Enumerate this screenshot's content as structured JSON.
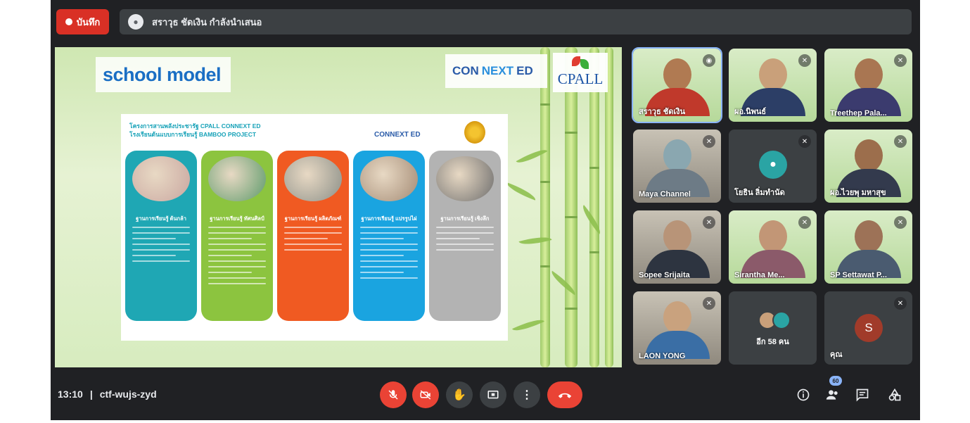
{
  "top_bar": {
    "record_label": "บันทึก",
    "presenter_text": "สราวุธ ชัดเงิน กำลังนำเสนอ"
  },
  "slide": {
    "title": "school model",
    "logo_connext_prefix": "CON",
    "logo_connext_next": "NEXT",
    "logo_connext_suffix": "ED",
    "logo_cpall": "CPALL",
    "panel_heading_line1": "โครงการสานพลังประชารัฐ CPALL CONNEXT ED",
    "panel_heading_line2": "โรงเรียนต้นแบบการเรียนรู้ BAMBOO PROJECT",
    "panel_logo": "CONNEXT ED",
    "pillars": [
      {
        "title": "ฐานการเรียนรู้ ต้นกล้า",
        "color": "#1fa7b4",
        "photo": "#c9a6a0",
        "lines": 7
      },
      {
        "title": "ฐานการเรียนรู้ ทัศนศิลป์",
        "color": "#8cc43f",
        "photo": "#5c9a6a",
        "lines": 11
      },
      {
        "title": "ฐานการเรียนรู้ ผลิตภัณฑ์",
        "color": "#f05a22",
        "photo": "#8b8f88",
        "lines": 5
      },
      {
        "title": "ฐานการเรียนรู้ แปรรูปไผ่",
        "color": "#1aa4e0",
        "photo": "#a38a74",
        "lines": 10
      },
      {
        "title": "ฐานการเรียนรู้ เชิงลึก",
        "color": "#b3b3b3",
        "photo": "#6d6d6d",
        "lines": 5
      }
    ]
  },
  "participants": [
    {
      "name": "สราวุธ ชัดเงิน",
      "style": "green",
      "skin": "#b07a52",
      "shirt": "#c0392b",
      "speaking": true
    },
    {
      "name": "ผอ.นิพนธ์",
      "style": "green",
      "skin": "#c9a07a",
      "shirt": "#2c3e66"
    },
    {
      "name": "Treethep Pala...",
      "style": "green",
      "skin": "#a97652",
      "shirt": "#3b3b6e"
    },
    {
      "name": "Maya Channel",
      "style": "room",
      "skin": "#8aa7b0",
      "shirt": "#6d7b86"
    },
    {
      "name": "โยธิน ลิ่มทำนัด",
      "style": "avatar"
    },
    {
      "name": "ผอ.ไวยพุ มหาสุข",
      "style": "green",
      "skin": "#9c6e4c",
      "shirt": "#333a4d"
    },
    {
      "name": "Sopee Srijaita",
      "style": "room",
      "skin": "#b89478",
      "shirt": "#2d3440"
    },
    {
      "name": "Sirantha Me...",
      "style": "green",
      "skin": "#c29676",
      "shirt": "#8b5a6a"
    },
    {
      "name": "SP Settawat P...",
      "style": "green",
      "skin": "#9d7257",
      "shirt": "#4a5b70"
    },
    {
      "name": "LAON YONG",
      "style": "room",
      "skin": "#c9a27e",
      "shirt": "#3a6ea5"
    },
    {
      "name": "อีก 58 คน",
      "style": "others"
    },
    {
      "name": "คุณ",
      "style": "self",
      "initial": "S"
    }
  ],
  "bottom_bar": {
    "time": "13:10",
    "separator": "|",
    "meeting_code": "ctf-wujs-zyd",
    "participants_count": "60"
  },
  "icons": {
    "record": "record-dot-icon",
    "mic_off": "mic-off-icon",
    "cam_off": "camera-off-icon",
    "hand": "raise-hand-icon",
    "present": "present-screen-icon",
    "more": "more-vert-icon",
    "end": "end-call-icon",
    "info": "info-icon",
    "people": "people-icon",
    "chat": "chat-icon",
    "activities": "activities-icon"
  }
}
